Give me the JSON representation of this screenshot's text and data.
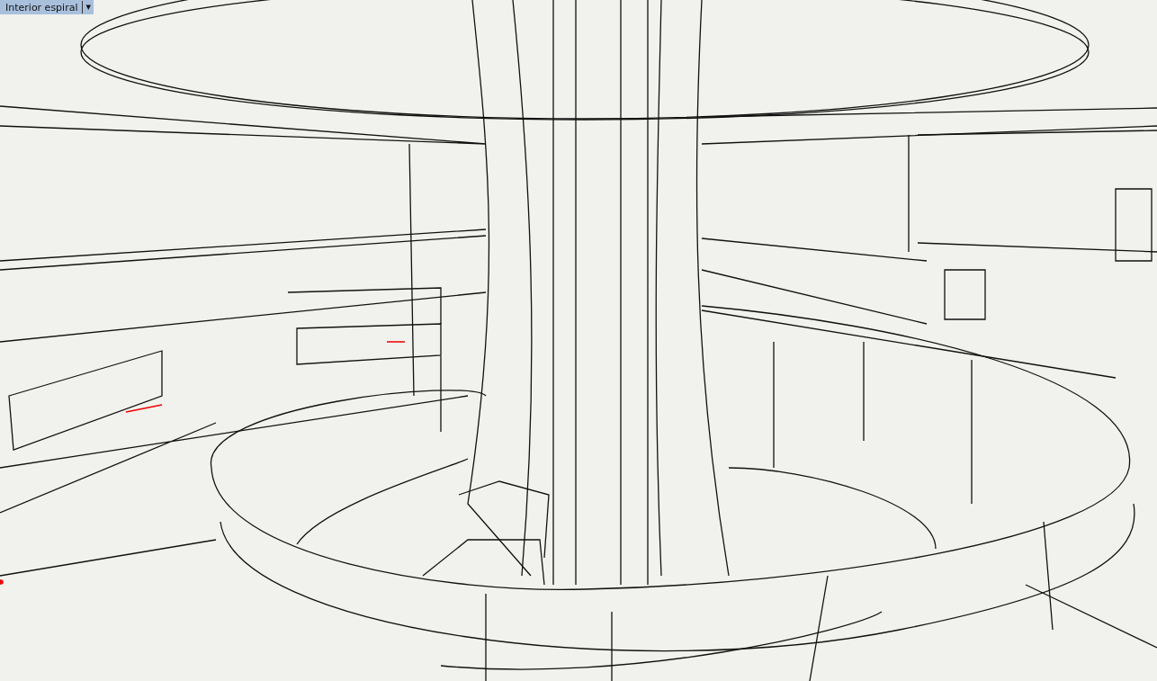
{
  "viewport": {
    "title": "Interior espiral",
    "menu_arrow": "▾"
  }
}
